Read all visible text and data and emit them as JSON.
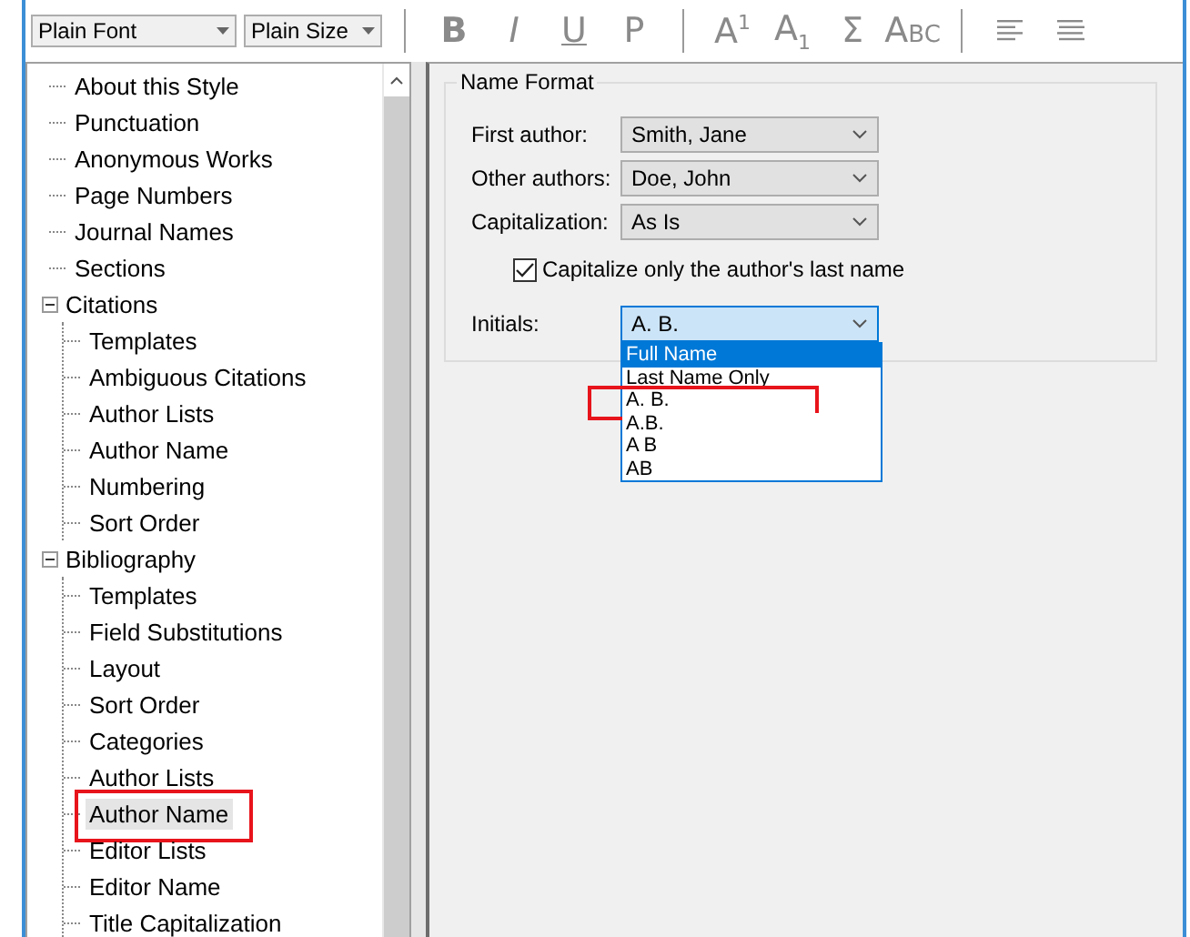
{
  "toolbar": {
    "font": "Plain Font",
    "size": "Plain Size",
    "buttons": [
      {
        "kind": "bold",
        "label": "B"
      },
      {
        "kind": "italic",
        "label": "I"
      },
      {
        "kind": "underline",
        "label": "U"
      },
      {
        "kind": "plain",
        "label": "P"
      },
      {
        "kind": "sep"
      },
      {
        "kind": "rich",
        "label": "A$^{1}$"
      },
      {
        "kind": "rich",
        "label": "A$_{1}$"
      },
      {
        "kind": "plain",
        "label": "Σ"
      },
      {
        "kind": "smallcaps",
        "label": "Abc"
      },
      {
        "kind": "sep"
      },
      {
        "kind": "align-left"
      },
      {
        "kind": "justify"
      }
    ]
  },
  "tree": [
    {
      "label": "About this Style",
      "selected": false,
      "annotated": false
    },
    {
      "label": "Punctuation",
      "selected": false,
      "annotated": false
    },
    {
      "label": "Anonymous Works",
      "selected": false,
      "annotated": false
    },
    {
      "label": "Page Numbers",
      "selected": false,
      "annotated": false
    },
    {
      "label": "Journal Names",
      "selected": false,
      "annotated": false
    },
    {
      "label": "Sections",
      "selected": false,
      "annotated": false
    },
    {
      "label": "Citations",
      "selected": false,
      "annotated": false,
      "expanded": true,
      "children": [
        {
          "label": "Templates",
          "selected": false,
          "annotated": false
        },
        {
          "label": "Ambiguous Citations",
          "selected": false,
          "annotated": false
        },
        {
          "label": "Author Lists",
          "selected": false,
          "annotated": false
        },
        {
          "label": "Author Name",
          "selected": false,
          "annotated": false
        },
        {
          "label": "Numbering",
          "selected": false,
          "annotated": false
        },
        {
          "label": "Sort Order",
          "selected": false,
          "annotated": false
        }
      ]
    },
    {
      "label": "Bibliography",
      "selected": false,
      "annotated": false,
      "expanded": true,
      "children": [
        {
          "label": "Templates",
          "selected": false,
          "annotated": false
        },
        {
          "label": "Field Substitutions",
          "selected": false,
          "annotated": false
        },
        {
          "label": "Layout",
          "selected": false,
          "annotated": false
        },
        {
          "label": "Sort Order",
          "selected": false,
          "annotated": false
        },
        {
          "label": "Categories",
          "selected": false,
          "annotated": false
        },
        {
          "label": "Author Lists",
          "selected": false,
          "annotated": false
        },
        {
          "label": "Author Name",
          "selected": true,
          "annotated": true
        },
        {
          "label": "Editor Lists",
          "selected": false,
          "annotated": false
        },
        {
          "label": "Editor Name",
          "selected": false,
          "annotated": false
        },
        {
          "label": "Title Capitalization",
          "selected": false,
          "annotated": false
        }
      ]
    }
  ],
  "name_format": {
    "title": "Name Format",
    "fields": [
      {
        "label": "First author:",
        "value": "Smith, Jane"
      },
      {
        "label": "Other authors:",
        "value": "Doe, John"
      },
      {
        "label": "Capitalization:",
        "value": "As Is"
      }
    ],
    "checkbox": {
      "label": "Capitalize only the author's last name",
      "checked": true
    },
    "initials": {
      "label": "Initials:",
      "value": "A. B.",
      "open": true,
      "options": [
        {
          "label": "Full Name",
          "highlighted": true,
          "annotated": false
        },
        {
          "label": "Last Name Only",
          "highlighted": false,
          "annotated": false
        },
        {
          "label": "A. B.",
          "highlighted": false,
          "annotated": true
        },
        {
          "label": "A.B.",
          "highlighted": false,
          "annotated": false
        },
        {
          "label": "A B",
          "highlighted": false,
          "annotated": false
        },
        {
          "label": "AB",
          "highlighted": false,
          "annotated": false
        }
      ]
    }
  }
}
